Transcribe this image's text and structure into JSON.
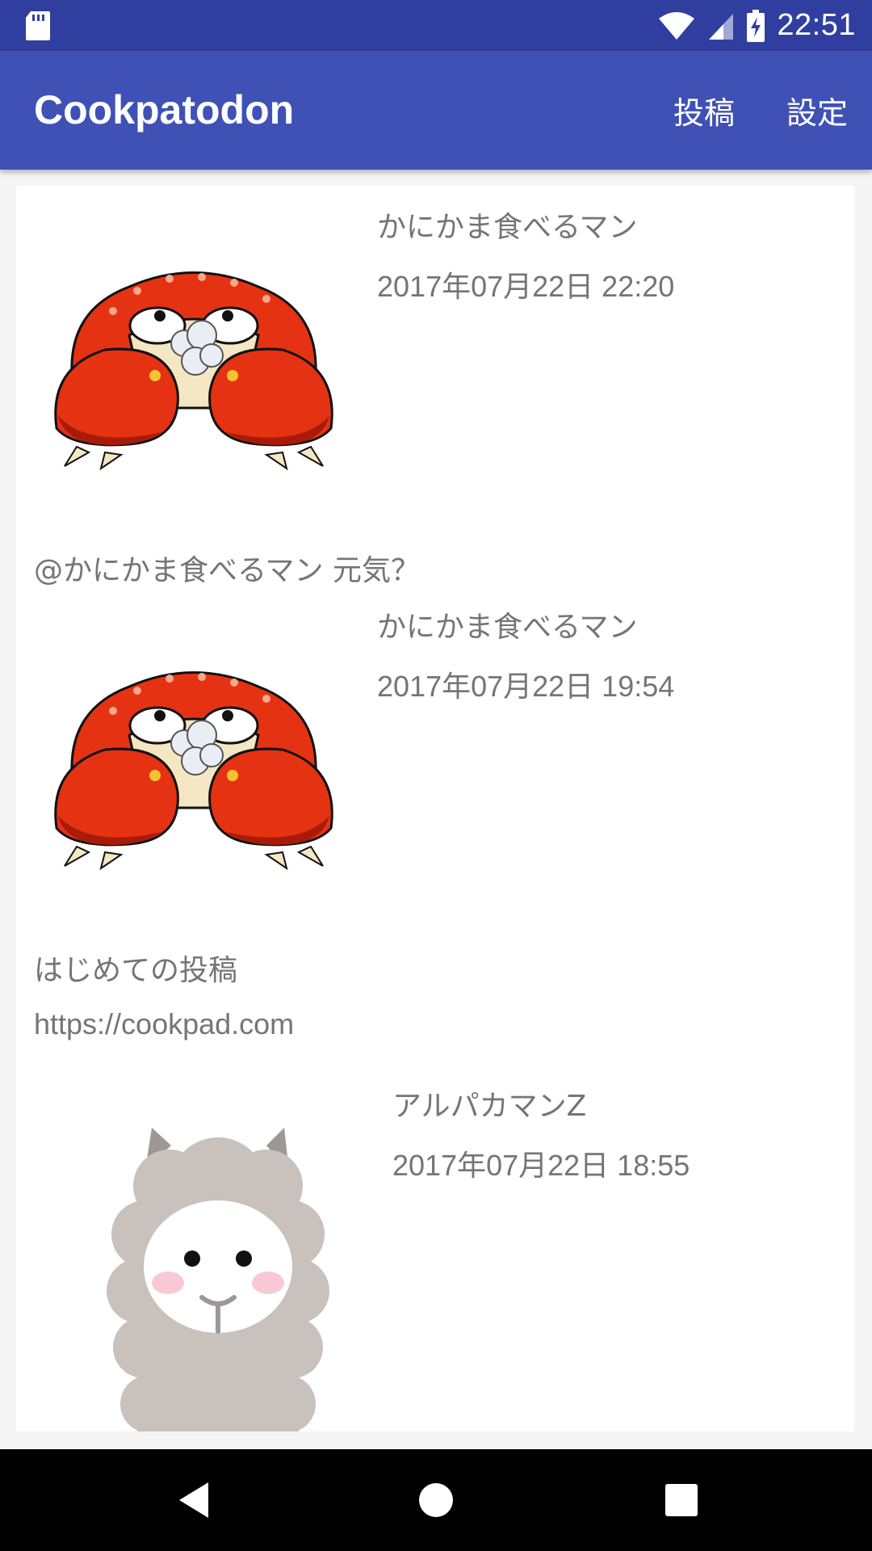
{
  "status_bar": {
    "time": "22:51",
    "icons": [
      "sd-card-icon",
      "wifi-icon",
      "cell-signal-icon",
      "battery-charging-icon"
    ]
  },
  "app_bar": {
    "title": "Cookpatodon",
    "actions": {
      "post_label": "投稿",
      "settings_label": "設定"
    }
  },
  "timeline": {
    "posts": [
      {
        "user": "かにかま食べるマン",
        "date": "2017年07月22日 22:20",
        "avatar": "crab-avatar",
        "body": "@かにかま食べるマン 元気？"
      },
      {
        "user": "かにかま食べるマン",
        "date": "2017年07月22日 19:54",
        "avatar": "crab-avatar",
        "body": "はじめての投稿",
        "link": "https://cookpad.com"
      },
      {
        "user": "アルパカマンZ",
        "date": "2017年07月22日 18:55",
        "avatar": "alpaca-avatar"
      }
    ]
  },
  "nav_bar": {
    "buttons": [
      "back-icon",
      "home-icon",
      "recents-icon"
    ]
  },
  "colors": {
    "status_bar": "#303f9f",
    "app_bar": "#3f51b5",
    "text_secondary": "#757575",
    "crab_red": "#e53212"
  }
}
